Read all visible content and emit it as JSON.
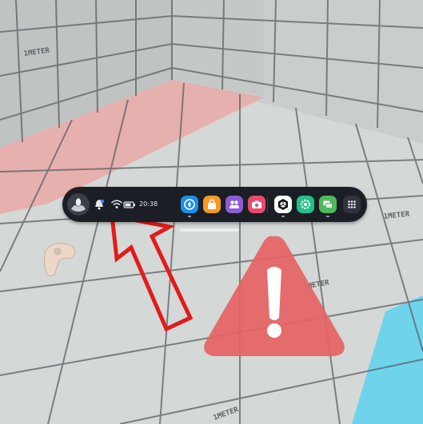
{
  "environment": {
    "floor_labels": [
      "1METER",
      "1METER",
      "1METER",
      "1METER"
    ],
    "colors": {
      "floor": "#d3d7d6",
      "wall": "#c3c7c6",
      "grid_line": "#5b5f63",
      "boundary_red": "#e8a5a3",
      "boundary_blue": "#6fd3ec"
    }
  },
  "dock": {
    "time": "20:38",
    "avatar_icon": "user-avatar-icon",
    "status_icons": [
      "notification-bell-icon",
      "wifi-icon",
      "battery-icon"
    ],
    "apps": [
      {
        "name": "explore-app",
        "icon": "compass-icon",
        "color": "#1b8fe8"
      },
      {
        "name": "store-app",
        "icon": "store-bag-icon",
        "color": "#f59a23"
      },
      {
        "name": "people-app",
        "icon": "people-icon",
        "color": "#8b5cd6"
      },
      {
        "name": "camera-app",
        "icon": "camera-icon",
        "color": "#e84c6c"
      },
      {
        "name": "unity-app",
        "icon": "unity-icon",
        "color": "#ffffff"
      },
      {
        "name": "settings-app",
        "icon": "gear-icon",
        "color": "#22c08a"
      },
      {
        "name": "window-app",
        "icon": "windows-icon",
        "color": "#4fb85c"
      },
      {
        "name": "app-library",
        "icon": "grid-icon",
        "color": "#2f333b"
      }
    ]
  },
  "overlays": {
    "warning_icon": "exclamation-warning-icon",
    "warning_color": "#e56364",
    "arrow_icon": "red-arrow-icon",
    "arrow_color": "#e21b1b",
    "controller_icon": "vr-controller-icon"
  }
}
